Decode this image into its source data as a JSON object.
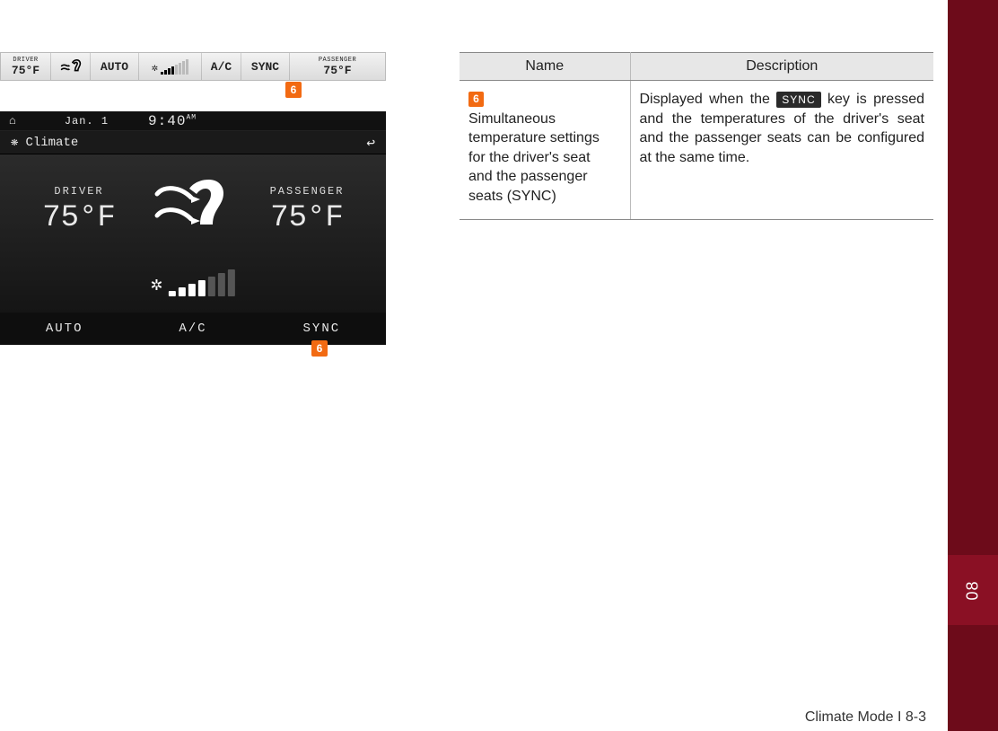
{
  "topbar": {
    "driver_label": "DRIVER",
    "driver_temp": "75°F",
    "auto": "AUTO",
    "ac": "A/C",
    "sync": "SYNC",
    "passenger_label": "PASSENGER",
    "passenger_temp": "75°F",
    "fan_level": 4,
    "fan_total": 8
  },
  "marker": "6",
  "screen": {
    "date": "Jan. 1",
    "time": "9:40",
    "ampm": "AM",
    "crumb": "Climate",
    "driver_label": "DRIVER",
    "driver_temp": "75°F",
    "passenger_label": "PASSENGER",
    "passenger_temp": "75°F",
    "fan_level": 4,
    "fan_total": 7,
    "btn_auto": "AUTO",
    "btn_ac": "A/C",
    "btn_sync": "SYNC"
  },
  "table": {
    "head_name": "Name",
    "head_desc": "Description",
    "row_num": "6",
    "row_name": "Simultaneous temperature settings for the driver's seat and the passenger seats (SYNC)",
    "row_desc_a": "Displayed when the ",
    "row_desc_key": "SYNC",
    "row_desc_b": " key is pressed and the temperatures of the driver's seat and the passenger seats can be configured at the same time."
  },
  "side_tab": "08",
  "footer": "Climate Mode I 8-3"
}
